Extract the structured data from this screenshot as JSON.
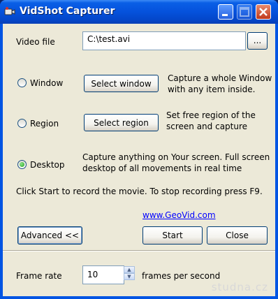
{
  "window": {
    "title": "VidShot Capturer",
    "icon": "film-camera-icon",
    "controls": [
      "minimize-icon",
      "maximize-icon",
      "close-icon"
    ]
  },
  "video_file": {
    "label": "Video file",
    "value": "C:\\test.avi",
    "browse_label": "..."
  },
  "modes": [
    {
      "label": "Window",
      "button": "Select window",
      "desc": "Capture a whole Window with any item inside.",
      "selected": false
    },
    {
      "label": "Region",
      "button": "Select region",
      "desc": "Set free region of the screen and capture",
      "selected": false
    },
    {
      "label": "Desktop",
      "button": "",
      "desc": "Capture anything on Your screen. Full screen desktop of all movements in real time",
      "selected": true
    }
  ],
  "instructions": "Click Start to record the movie. To stop recording press F9.",
  "link": "www.GeoVid.com",
  "buttons": {
    "advanced": "Advanced <<",
    "start": "Start",
    "close": "Close"
  },
  "frame_rate": {
    "label": "Frame rate",
    "value": "10",
    "unit": "frames per second"
  },
  "watermark": "studna.cz"
}
